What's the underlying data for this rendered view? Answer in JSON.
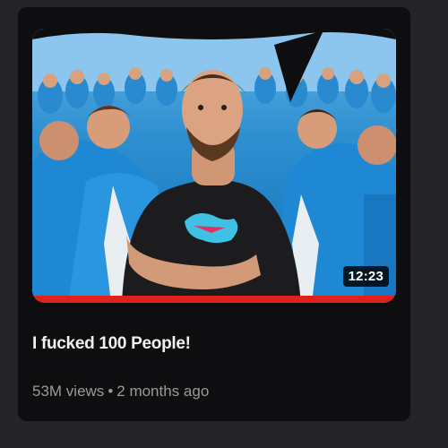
{
  "video": {
    "title": "I fucked 100 People!",
    "duration": "12:23",
    "views": "53M views",
    "separator": "•",
    "age": "2 months ago",
    "watched_fraction": 1.0,
    "progress_color": "#e0231a"
  }
}
